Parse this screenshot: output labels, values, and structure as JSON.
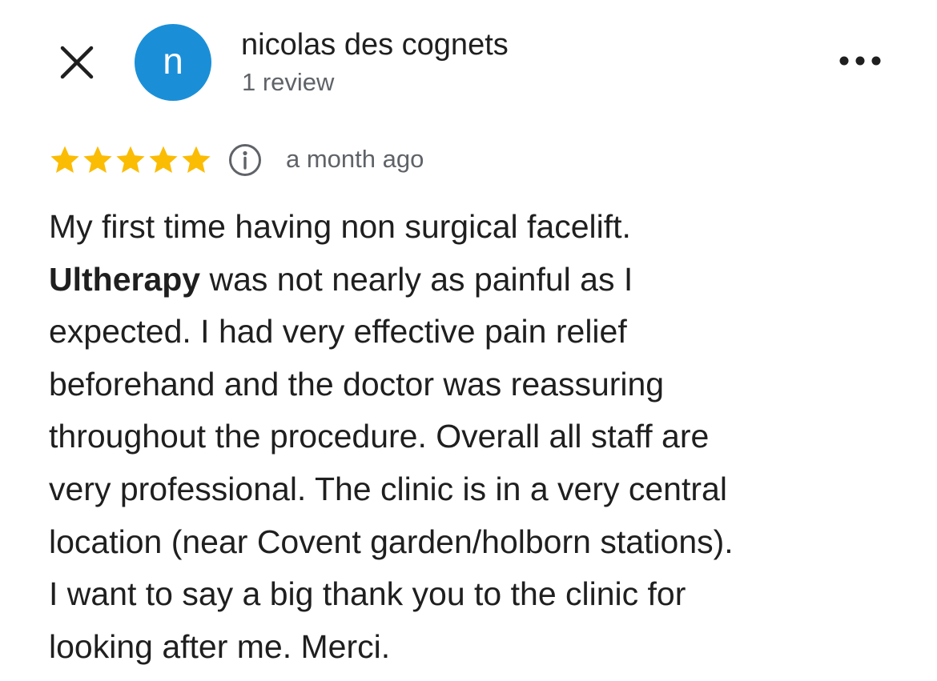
{
  "header": {
    "close_icon": "close-icon",
    "avatar_letter": "n",
    "avatar_color": "#1a8fd8",
    "name": "nicolas des cognets",
    "review_count": "1 review",
    "more_icon": "more-horiz-icon"
  },
  "rating": {
    "stars": 5,
    "star_color": "#fbbc04",
    "info_icon": "info-icon",
    "time": "a month ago"
  },
  "review": {
    "keyword": "Ultherapy",
    "lines": [
      "My first time having non surgical facelift.",
      " was not nearly as painful as I",
      "expected. I had very effective pain relief",
      "beforehand and the doctor was reassuring",
      "throughout the procedure. Overall all staff are",
      "very professional. The clinic is in a very central",
      "location (near Covent garden/holborn stations).",
      "I want to say a big thank you to the clinic for",
      "looking after me. Merci."
    ]
  }
}
